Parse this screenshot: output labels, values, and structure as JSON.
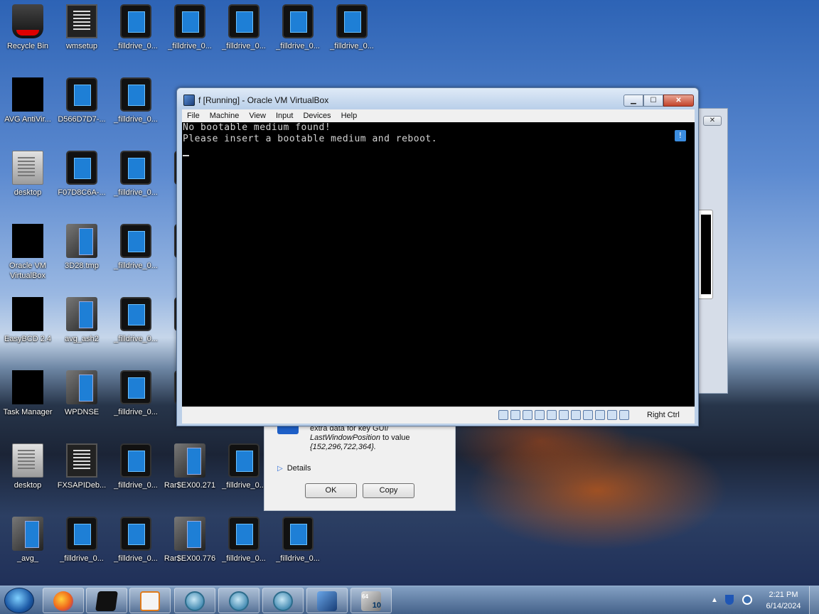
{
  "desktop_icons": [
    {
      "label": "Recycle Bin",
      "icon": "recycle-bin-icon"
    },
    {
      "label": "wmsetup",
      "icon": "document-icon"
    },
    {
      "label": "_filldrive_0...",
      "icon": "tablet-icon"
    },
    {
      "label": "_filldrive_0...",
      "icon": "tablet-icon"
    },
    {
      "label": "_filldrive_0...",
      "icon": "tablet-icon"
    },
    {
      "label": "_filldrive_0...",
      "icon": "tablet-icon"
    },
    {
      "label": "_filldrive_0...",
      "icon": "tablet-icon"
    },
    {
      "label": "AVG AntiVir...",
      "icon": "avg-antivirus-icon"
    },
    {
      "label": "D566D7D7-...",
      "icon": "tablet-icon"
    },
    {
      "label": "_filldrive_0...",
      "icon": "tablet-icon"
    },
    {
      "label": "desktop",
      "icon": "settings-file-icon"
    },
    {
      "label": "F07D8C6A-...",
      "icon": "tablet-icon"
    },
    {
      "label": "_filldrive_0...",
      "icon": "tablet-icon"
    },
    {
      "label": "_fil",
      "icon": "tablet-icon"
    },
    {
      "label": "Oracle VM VirtualBox",
      "icon": "virtualbox-icon"
    },
    {
      "label": "3D28.tmp",
      "icon": "folder-file-icon"
    },
    {
      "label": "_filldrive_0...",
      "icon": "tablet-icon"
    },
    {
      "label": "_fil",
      "icon": "tablet-icon"
    },
    {
      "label": "EasyBCD 2.4",
      "icon": "easybcd-icon"
    },
    {
      "label": "avg_ash2",
      "icon": "folder-file-icon"
    },
    {
      "label": "_filldrive_0...",
      "icon": "tablet-icon"
    },
    {
      "label": "_fil",
      "icon": "tablet-icon"
    },
    {
      "label": "Task Manager",
      "icon": "task-manager-icon"
    },
    {
      "label": "WPDNSE",
      "icon": "folder-file-icon"
    },
    {
      "label": "_filldrive_0...",
      "icon": "tablet-icon"
    },
    {
      "label": "_fil",
      "icon": "tablet-icon"
    },
    {
      "label": "desktop",
      "icon": "settings-file-icon"
    },
    {
      "label": "FXSAPIDeb...",
      "icon": "document-icon"
    },
    {
      "label": "_filldrive_0...",
      "icon": "tablet-icon"
    },
    {
      "label": "Rar$EX00.271",
      "icon": "folder-file-icon"
    },
    {
      "label": "_filldrive_0...",
      "icon": "tablet-icon"
    },
    {
      "label": "_avg_",
      "icon": "folder-file-icon"
    },
    {
      "label": "_filldrive_0...",
      "icon": "tablet-icon"
    },
    {
      "label": "_filldrive_0...",
      "icon": "tablet-icon"
    },
    {
      "label": "Rar$EX00.776",
      "icon": "folder-file-icon"
    },
    {
      "label": "_filldrive_0...",
      "icon": "tablet-icon"
    },
    {
      "label": "_filldrive_0...",
      "icon": "tablet-icon"
    }
  ],
  "vbox_window": {
    "title": "f [Running] - Oracle VM VirtualBox",
    "menu": [
      "File",
      "Machine",
      "View",
      "Input",
      "Devices",
      "Help"
    ],
    "screen_lines": [
      "No bootable medium found!",
      "Please insert a bootable medium and reboot."
    ],
    "status_text": "Right Ctrl"
  },
  "error_dialog": {
    "line1": "extra data for key GUI/",
    "line2_italic": "LastWindowPosition",
    "line2_rest": " to value",
    "line3_italic": "{152,296,722,364}.",
    "details_label": "Details",
    "ok_label": "OK",
    "copy_label": "Copy"
  },
  "taskbar": {
    "time": "2:21 PM",
    "date": "6/14/2024",
    "badge_top": "64",
    "badge_num": "10"
  }
}
